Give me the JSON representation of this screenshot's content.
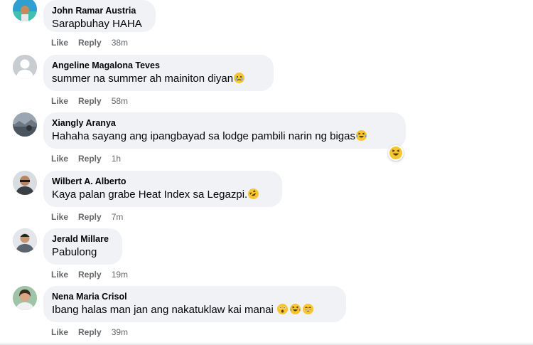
{
  "actions": {
    "like_label": "Like",
    "reply_label": "Reply"
  },
  "comments": [
    {
      "author": "John Ramar Austria",
      "text": "Sarapbuhay HAHA",
      "time": "38m",
      "emojis": [],
      "avatar_icon": "beach-photo-avatar"
    },
    {
      "author": "Angeline Magalona Teves",
      "text": "summer na summer ah mainiton diyan",
      "time": "58m",
      "emojis": [
        "crying-face-emoji"
      ],
      "avatar_icon": "default-person-avatar"
    },
    {
      "author": "Xiangly Aranya",
      "text": "Hahaha sayang ang ipangbayad sa lodge pambili narin ng bigas",
      "time": "1h",
      "emojis": [
        "laughing-tears-emoji"
      ],
      "reaction": "haha-reaction-icon",
      "avatar_icon": "landscape-photo-avatar"
    },
    {
      "author": "Wilbert A. Alberto",
      "text": "Kaya palan grabe Heat Index sa Legazpi.",
      "time": "7m",
      "emojis": [
        "rolling-laughing-emoji"
      ],
      "avatar_icon": "portrait-photo-avatar"
    },
    {
      "author": "Jerald Millare",
      "text": "Pabulong",
      "time": "19m",
      "emojis": [],
      "avatar_icon": "portrait-photo-avatar"
    },
    {
      "author": "Nena Maria Crisol",
      "text": "Ibang halas man jan ang nakatuklaw kai manai ",
      "time": "39m",
      "emojis": [
        "astonished-face-emoji",
        "laughing-tears-emoji",
        "grinning-face-emoji"
      ],
      "avatar_icon": "portrait-photo-avatar"
    }
  ],
  "colors": {
    "bubble": "#f0f2f5",
    "meta_text": "#65676b",
    "emoji": "#f7c531"
  }
}
